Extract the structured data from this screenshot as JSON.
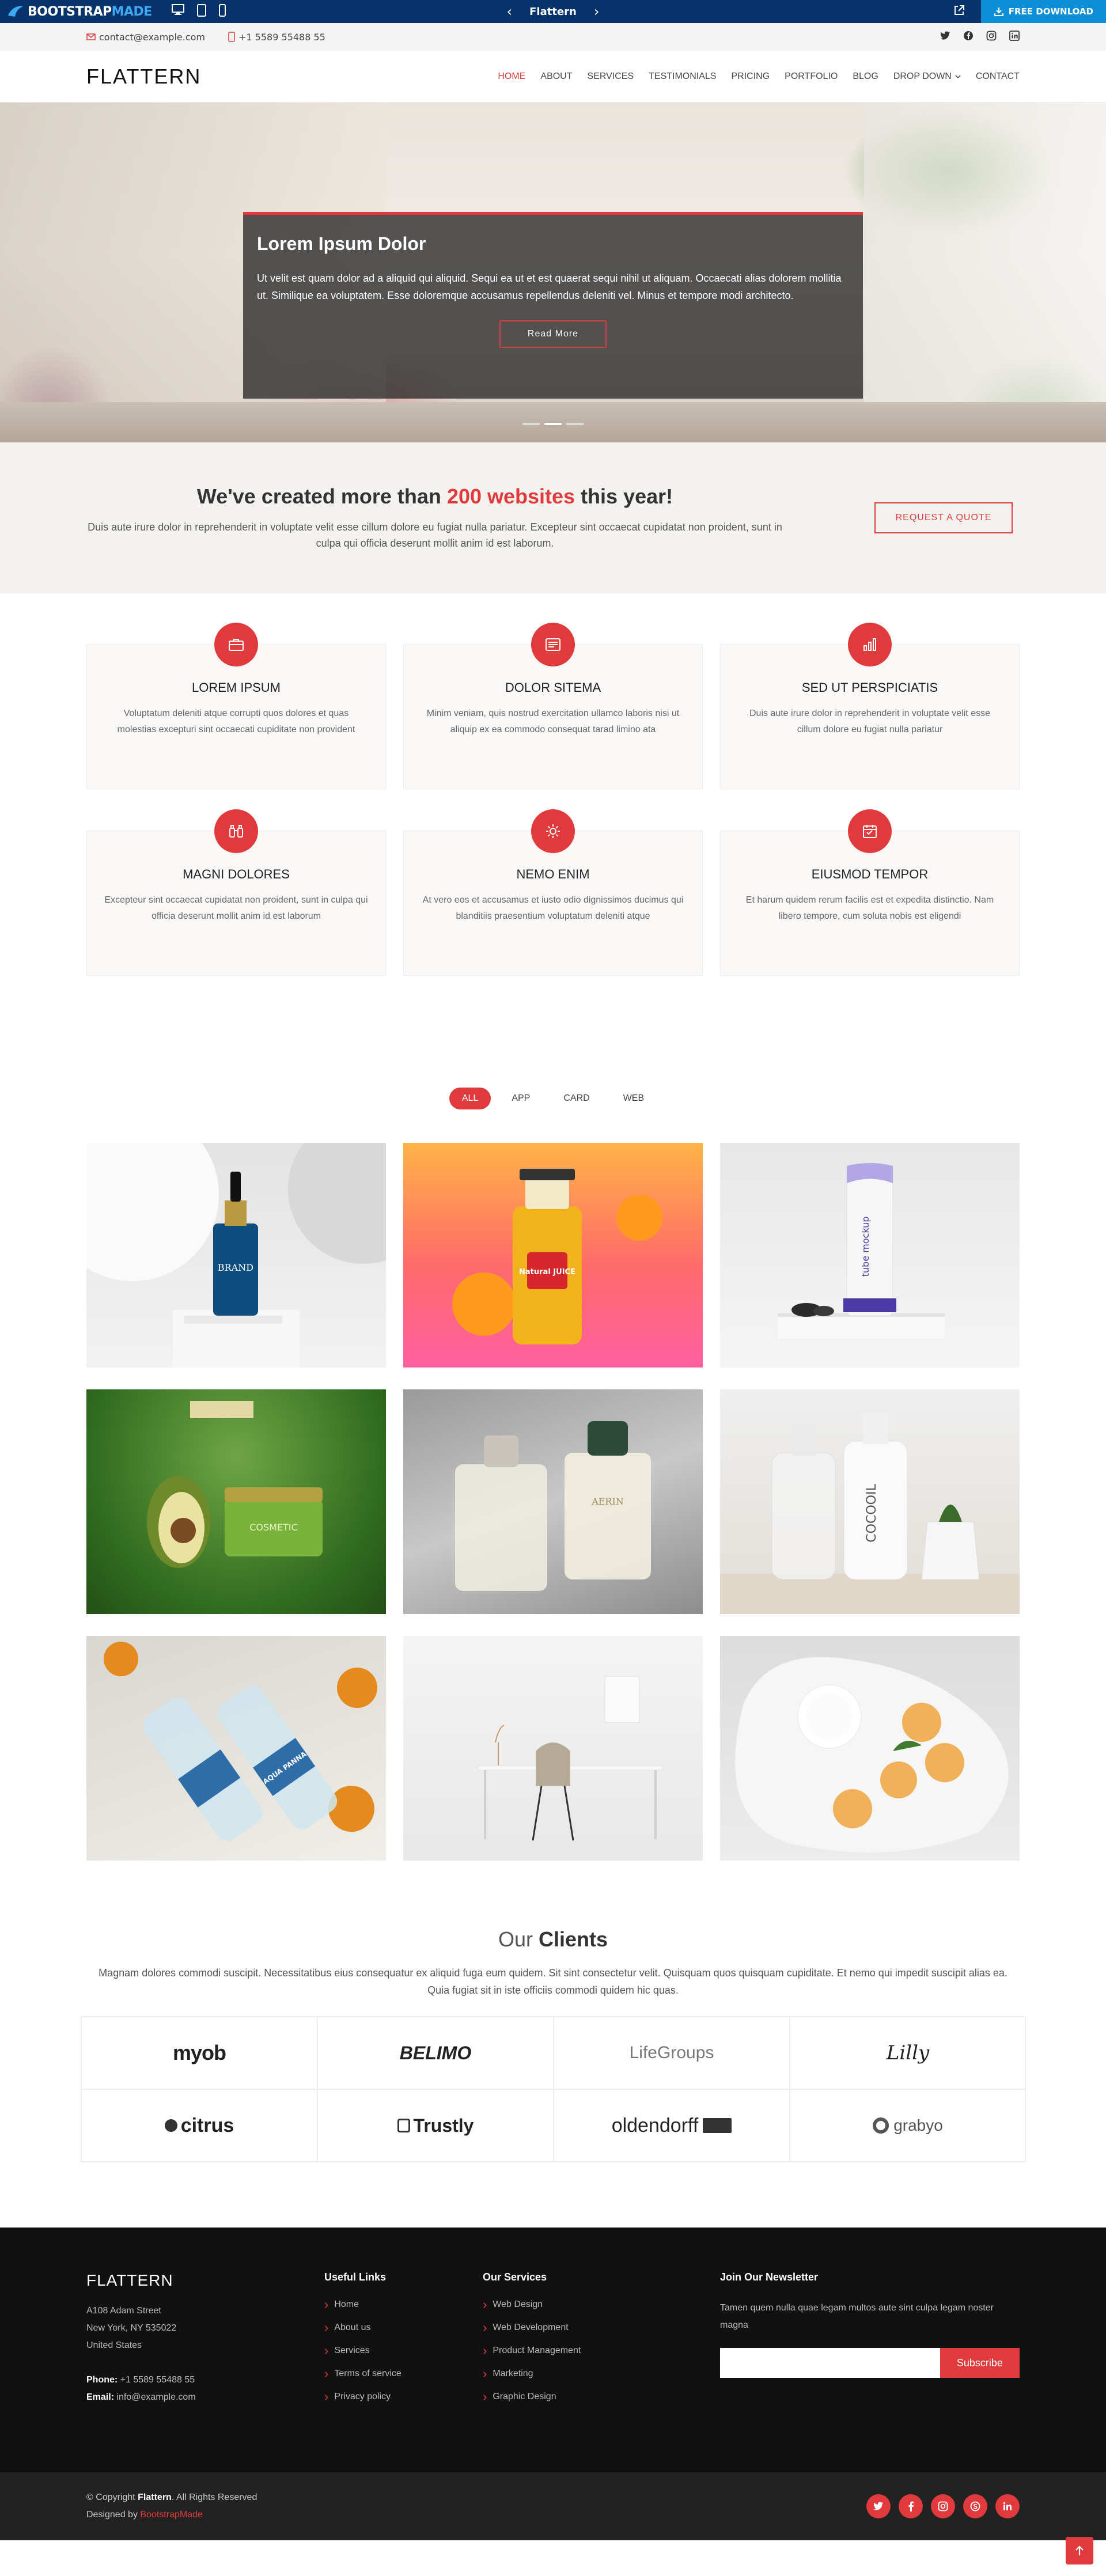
{
  "preview_bar": {
    "brand_primary": "BOOTSTRAP",
    "brand_secondary": "MADE",
    "title": "Flattern",
    "download_label": "FREE DOWNLOAD"
  },
  "topbar": {
    "email": "contact@example.com",
    "phone": "+1 5589 55488 55"
  },
  "header": {
    "logo": "FLATTERN",
    "nav": [
      "HOME",
      "ABOUT",
      "SERVICES",
      "TESTIMONIALS",
      "PRICING",
      "PORTFOLIO",
      "BLOG",
      "DROP DOWN",
      "CONTACT"
    ]
  },
  "hero": {
    "title": "Lorem Ipsum Dolor",
    "text": "Ut velit est quam dolor ad a aliquid qui aliquid. Sequi ea ut et est quaerat sequi nihil ut aliquam. Occaecati alias dolorem mollitia ut. Similique ea voluptatem. Esse doloremque accusamus repellendus deleniti vel. Minus et tempore modi architecto.",
    "button": "Read More"
  },
  "cta": {
    "title_pre": "We've created more than ",
    "title_highlight": "200 websites",
    "title_post": " this year!",
    "text": "Duis aute irure dolor in reprehenderit in voluptate velit esse cillum dolore eu fugiat nulla pariatur. Excepteur sint occaecat cupidatat non proident, sunt in culpa qui officia deserunt mollit anim id est laborum.",
    "button": "REQUEST A QUOTE"
  },
  "services": [
    {
      "title": "LOREM IPSUM",
      "text": "Voluptatum deleniti atque corrupti quos dolores et quas molestias excepturi sint occaecati cupiditate non provident",
      "icon": "briefcase-icon"
    },
    {
      "title": "DOLOR SITEMA",
      "text": "Minim veniam, quis nostrud exercitation ullamco laboris nisi ut aliquip ex ea commodo consequat tarad limino ata",
      "icon": "card-checklist-icon"
    },
    {
      "title": "SED UT PERSPICIATIS",
      "text": "Duis aute irure dolor in reprehenderit in voluptate velit esse cillum dolore eu fugiat nulla pariatur",
      "icon": "bar-chart-icon"
    },
    {
      "title": "MAGNI DOLORES",
      "text": "Excepteur sint occaecat cupidatat non proident, sunt in culpa qui officia deserunt mollit anim id est laborum",
      "icon": "binoculars-icon"
    },
    {
      "title": "NEMO ENIM",
      "text": "At vero eos et accusamus et iusto odio dignissimos ducimus qui blanditiis praesentium voluptatum deleniti atque",
      "icon": "brightness-icon"
    },
    {
      "title": "EIUSMOD TEMPOR",
      "text": "Et harum quidem rerum facilis est et expedita distinctio. Nam libero tempore, cum soluta nobis est eligendi",
      "icon": "calendar-icon"
    }
  ],
  "portfolio": {
    "filters": [
      "ALL",
      "APP",
      "CARD",
      "WEB"
    ],
    "items": [
      {
        "text": "BRAND"
      },
      {
        "text": "Natural JUICE"
      },
      {
        "text": "tube mockup"
      },
      {
        "text": "COSMETIC"
      },
      {
        "text": "AERIN"
      },
      {
        "text": "COCOOIL"
      },
      {
        "text": "AQUA PANNA"
      },
      {
        "text": ""
      },
      {
        "text": ""
      }
    ]
  },
  "clients": {
    "title_light": "Our ",
    "title_bold": "Clients",
    "text": "Magnam dolores commodi suscipit. Necessitatibus eius consequatur ex aliquid fuga eum quidem. Sit sint consectetur velit. Quisquam quos quisquam cupiditate. Et nemo qui impedit suscipit alias ea. Quia fugiat sit in iste officiis commodi quidem hic quas.",
    "logos": [
      "myob",
      "BELIMO",
      "LifeGroups",
      "Lilly",
      "citrus",
      "Trustly",
      "oldendorff",
      "grabyo"
    ]
  },
  "footer": {
    "brand": "FLATTERN",
    "address_1": "A108 Adam Street",
    "address_2": "New York, NY 535022",
    "address_3": "United States",
    "phone_label": "Phone:",
    "phone": " +1 5589 55488 55",
    "email_label": "Email:",
    "email": " info@example.com",
    "useful_title": "Useful Links",
    "useful_links": [
      "Home",
      "About us",
      "Services",
      "Terms of service",
      "Privacy policy"
    ],
    "services_title": "Our Services",
    "services_links": [
      "Web Design",
      "Web Development",
      "Product Management",
      "Marketing",
      "Graphic Design"
    ],
    "newsletter_title": "Join Our Newsletter",
    "newsletter_text": "Tamen quem nulla quae legam multos aute sint culpa legam noster magna",
    "subscribe": "Subscribe",
    "copyright_pre": "© Copyright ",
    "copyright_brand": "Flattern",
    "copyright_post": ". All Rights Reserved",
    "designed_by": "Designed by ",
    "designer": "BootstrapMade"
  },
  "colors": {
    "accent": "#e03a3c",
    "preview_bar": "#06346a",
    "download": "#0d8fd8"
  }
}
